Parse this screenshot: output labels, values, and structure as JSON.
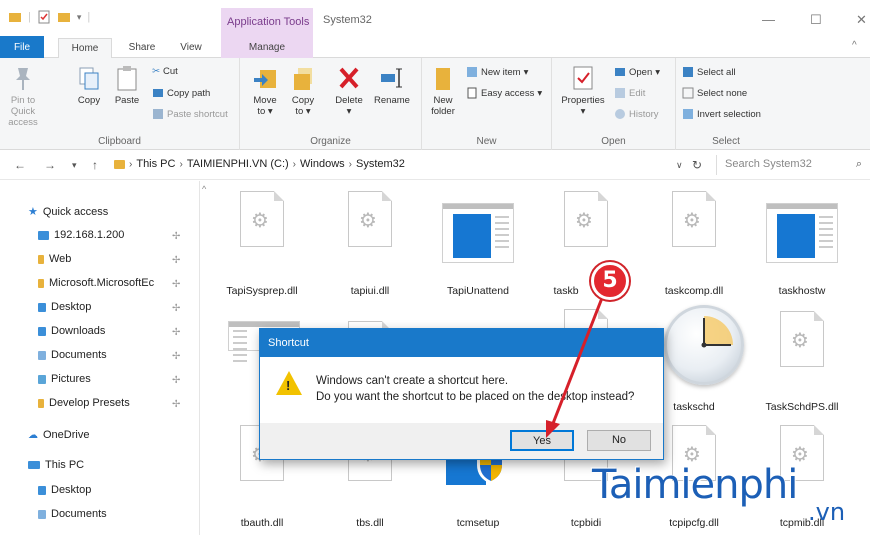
{
  "window": {
    "context_tab": "Application Tools",
    "title": "System32"
  },
  "tabs": {
    "file": "File",
    "home": "Home",
    "share": "Share",
    "view": "View",
    "manage": "Manage"
  },
  "ribbon": {
    "clipboard": {
      "label": "Clipboard",
      "pin": "Pin to Quick access",
      "copy": "Copy",
      "paste": "Paste",
      "cut": "Cut",
      "copy_path": "Copy path",
      "paste_shortcut": "Paste shortcut"
    },
    "organize": {
      "label": "Organize",
      "move_to": "Move to",
      "copy_to": "Copy to",
      "delete": "Delete",
      "rename": "Rename"
    },
    "new": {
      "label": "New",
      "new_folder": "New folder",
      "new_item": "New item",
      "easy_access": "Easy access"
    },
    "open": {
      "label": "Open",
      "properties": "Properties",
      "open": "Open",
      "edit": "Edit",
      "history": "History"
    },
    "select": {
      "label": "Select",
      "select_all": "Select all",
      "select_none": "Select none",
      "invert_selection": "Invert selection"
    }
  },
  "address": {
    "crumbs": [
      "This PC",
      "TAIMIENPHI.VN (C:)",
      "Windows",
      "System32"
    ],
    "search_placeholder": "Search System32"
  },
  "nav": {
    "quick_access": "Quick access",
    "items": [
      "192.168.1.200",
      "Web",
      "Microsoft.MicrosoftEc",
      "Desktop",
      "Downloads",
      "Documents",
      "Pictures",
      "Develop Presets"
    ],
    "onedrive": "OneDrive",
    "this_pc": "This PC",
    "pc_items": [
      "Desktop",
      "Documents"
    ]
  },
  "files": {
    "row1": [
      "TapiSysprep.dll",
      "tapiui.dll",
      "TapiUnattend",
      "taskb",
      "taskcomp.dll",
      "taskhostw"
    ],
    "row2": [
      "taskschd",
      "TaskSchdPS.dll"
    ],
    "row3": [
      "tbauth.dll",
      "tbs.dll",
      "tcmsetup",
      "tcpbidi",
      "tcpipcfg.dll",
      "tcpmib.dll"
    ]
  },
  "dialog": {
    "title": "Shortcut",
    "line1": "Windows can't create a shortcut here.",
    "line2": "Do you want the shortcut to be placed on the desktop instead?",
    "yes": "Yes",
    "no": "No"
  },
  "annotation": {
    "step": "5",
    "color": "#e3282f"
  },
  "watermark": {
    "main": "Taimienphi",
    "suffix": ".vn"
  },
  "colors": {
    "accent": "#1979ca",
    "context_tab": "#ecd7f2"
  }
}
